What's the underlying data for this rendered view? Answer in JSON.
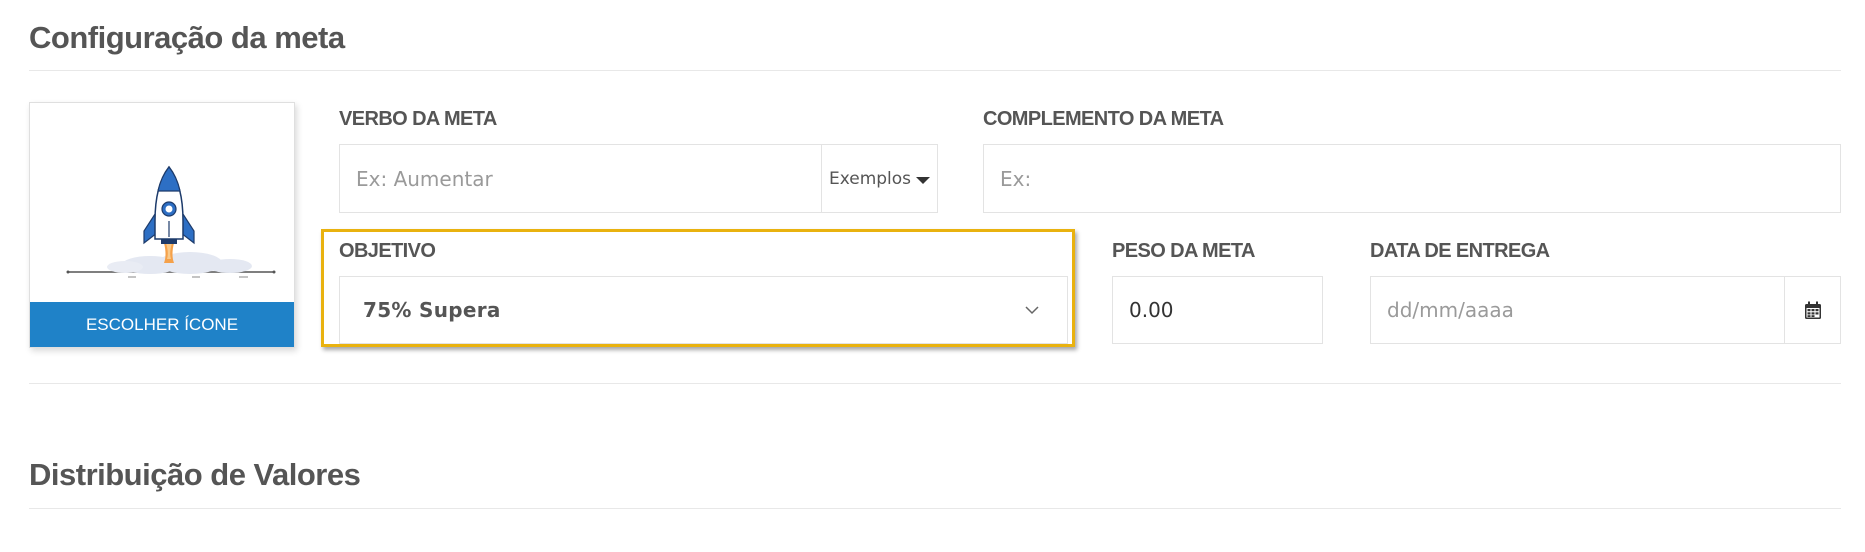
{
  "sections": {
    "config_title": "Configuração da meta",
    "distribution_title": "Distribuição de Valores"
  },
  "icon_card": {
    "button_label": "ESCOLHER ÍCONE",
    "icon": "rocket-icon"
  },
  "fields": {
    "verb": {
      "label": "VERBO DA META",
      "placeholder": "Ex: Aumentar",
      "examples_label": "Exemplos"
    },
    "complement": {
      "label": "COMPLEMENTO DA META",
      "placeholder": "Ex:"
    },
    "objective": {
      "label": "OBJETIVO",
      "value": "75% Supera"
    },
    "weight": {
      "label": "PESO DA META",
      "value": "0.00"
    },
    "delivery_date": {
      "label": "DATA DE ENTREGA",
      "placeholder": "dd/mm/aaaa",
      "icon": "calendar-icon"
    }
  },
  "colors": {
    "accent": "#1f82c8",
    "highlight": "#e9b20f",
    "text": "#555555"
  }
}
